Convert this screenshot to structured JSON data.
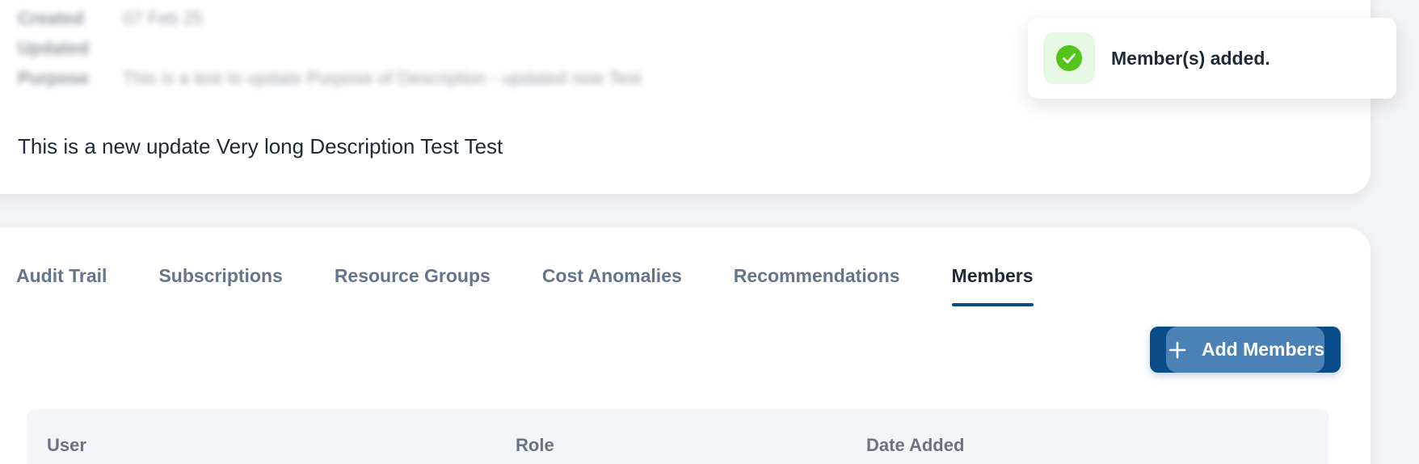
{
  "details": {
    "rows": [
      {
        "label": "Created",
        "value": "07 Feb 25"
      },
      {
        "label": "Updated",
        "value": ""
      },
      {
        "label": "Purpose",
        "value": "This is a test to update Purpose of Description - updated now Test"
      }
    ],
    "description": "This is a new update Very long Description Test Test"
  },
  "tabs": [
    {
      "label": "Audit Trail",
      "active": false
    },
    {
      "label": "Subscriptions",
      "active": false
    },
    {
      "label": "Resource Groups",
      "active": false
    },
    {
      "label": "Cost Anomalies",
      "active": false
    },
    {
      "label": "Recommendations",
      "active": false
    },
    {
      "label": "Members",
      "active": true
    }
  ],
  "actions": {
    "add_members_label": "Add Members",
    "add_icon": "plus-icon"
  },
  "table": {
    "columns": [
      "User",
      "Role",
      "Date Added"
    ]
  },
  "toast": {
    "message": "Member(s) added.",
    "icon": "check-circle-icon",
    "status_color": "#52c41a"
  },
  "colors": {
    "accent": "#0a4c8a",
    "accent_highlight": "#4a82b6"
  }
}
